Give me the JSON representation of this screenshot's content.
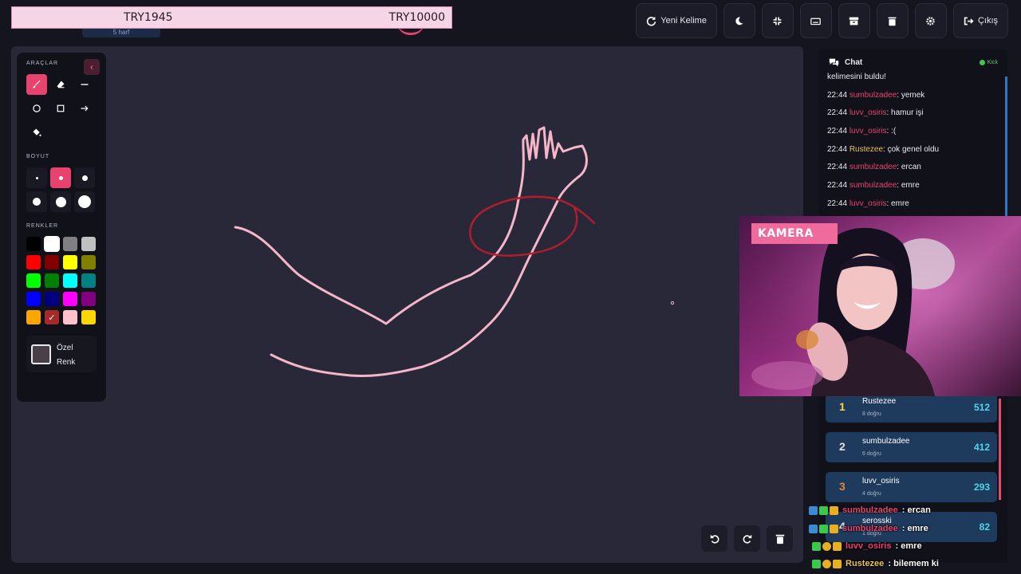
{
  "banner": {
    "camera_label": "KAMERA",
    "left_prize": "TRY1945",
    "right_prize": "TRY10000",
    "word_hint": "5 harf"
  },
  "toolbar": {
    "new_word_label": "Yeni Kelime",
    "exit_label": "Çıkış"
  },
  "tools": {
    "tools_label": "ARAÇLAR",
    "size_label": "BOYUT",
    "colors_label": "RENKLER",
    "custom_color_line1": "Özel",
    "custom_color_line2": "Renk",
    "swatches": [
      "#000000",
      "#ffffff",
      "#808080",
      "#c0c0c0",
      "#ff0000",
      "#800000",
      "#ffff00",
      "#808000",
      "#00ff00",
      "#008000",
      "#00ffff",
      "#008080",
      "#0000ff",
      "#000080",
      "#ff00ff",
      "#800080",
      "#ffa500",
      "#a52a2a",
      "#ffc0cb",
      "#ffd700"
    ]
  },
  "chat": {
    "title": "Chat",
    "platform": "Kick",
    "partial_first": "kelimesini buldu!",
    "messages": [
      {
        "time": "22:44",
        "user": "sumbulzadee",
        "color": "#e8436f",
        "text": ": yemek"
      },
      {
        "time": "22:44",
        "user": "luvv_osiris",
        "color": "#e8436f",
        "text": ": hamur işi"
      },
      {
        "time": "22:44",
        "user": "luvv_osiris",
        "color": "#e8436f",
        "text": ": :("
      },
      {
        "time": "22:44",
        "user": "Rustezee",
        "color": "#e8c060",
        "text": ": çok genel oldu"
      },
      {
        "time": "22:44",
        "user": "sumbulzadee",
        "color": "#e8436f",
        "text": ": ercan"
      },
      {
        "time": "22:44",
        "user": "sumbulzadee",
        "color": "#e8436f",
        "text": ": emre"
      },
      {
        "time": "22:44",
        "user": "luvv_osiris",
        "color": "#e8436f",
        "text": ": emre"
      }
    ]
  },
  "leaderboard": [
    {
      "rank": "1",
      "name": "Rustezee",
      "sub": "8 doğru",
      "score": "512",
      "rank_color": "#ffd23f"
    },
    {
      "rank": "2",
      "name": "sumbulzadee",
      "sub": "6 doğru",
      "score": "412",
      "rank_color": "#dde2ea"
    },
    {
      "rank": "3",
      "name": "luvv_osiris",
      "sub": "4 doğru",
      "score": "293",
      "rank_color": "#e08a3a"
    },
    {
      "rank": "4",
      "name": "serosski",
      "sub": "1 doğru",
      "score": "82",
      "rank_color": "#dde2ea"
    }
  ],
  "overlay_chat": [
    {
      "user": "sumbulzadee",
      "color": "#e8436f",
      "text": " : ercan"
    },
    {
      "user": "sumbulzadee",
      "color": "#e8436f",
      "text": " : emre"
    },
    {
      "user": "luvv_osiris",
      "color": "#e8436f",
      "text": " : emre"
    },
    {
      "user": "Rustezee",
      "color": "#e8c060",
      "text": " : bilemem ki"
    }
  ]
}
